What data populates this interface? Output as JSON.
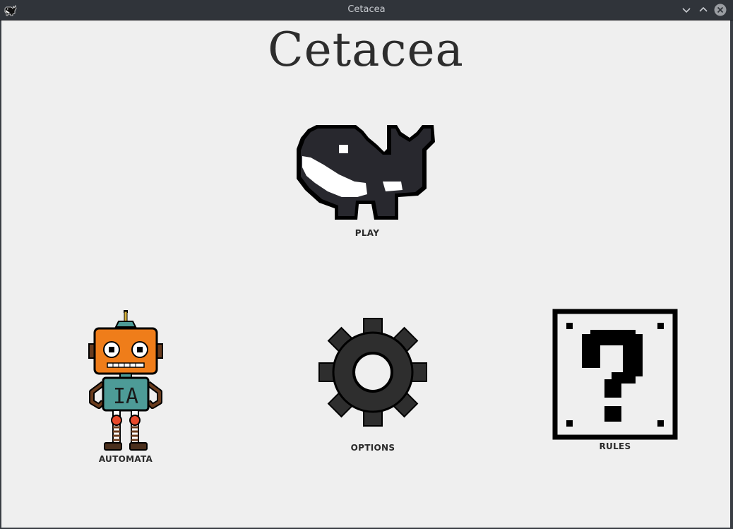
{
  "window": {
    "title": "Cetacea",
    "controls": {
      "minimize_icon": "chevron-down-icon",
      "maximize_icon": "chevron-up-icon",
      "close_icon": "close-circle-icon"
    }
  },
  "main": {
    "title": "Cetacea",
    "buttons": {
      "play": {
        "label": "PLAY",
        "icon": "whale-icon"
      },
      "automata": {
        "label": "AUTOMATA",
        "icon": "robot-icon",
        "robot_text": "IA"
      },
      "options": {
        "label": "OPTIONS",
        "icon": "gear-icon"
      },
      "rules": {
        "label": "RULES",
        "icon": "question-block-icon"
      }
    }
  },
  "colors": {
    "background": "#efefef",
    "titlebar": "#30343a",
    "whale_body": "#26262b",
    "robot_head": "#ef7d1a",
    "robot_body": "#4d9b97",
    "robot_legs": "#e84a2c",
    "gear": "#2e2e2e"
  }
}
